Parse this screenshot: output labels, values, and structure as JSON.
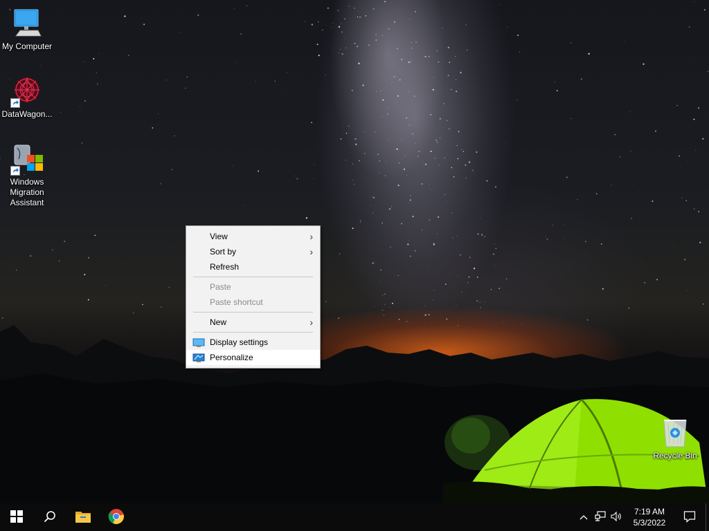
{
  "desktop": {
    "icons": [
      {
        "label": "My Computer",
        "icon": "monitor-icon"
      },
      {
        "label": "DataWagon...",
        "icon": "datawagon-icon"
      },
      {
        "label": "Windows Migration Assistant",
        "icon": "migration-assistant-icon"
      },
      {
        "label": "Recycle Bin",
        "icon": "recycle-bin-icon"
      }
    ]
  },
  "context_menu": {
    "items": [
      {
        "label": "View",
        "submenu": true,
        "enabled": true
      },
      {
        "label": "Sort by",
        "submenu": true,
        "enabled": true
      },
      {
        "label": "Refresh",
        "submenu": false,
        "enabled": true
      },
      {
        "label": "Paste",
        "submenu": false,
        "enabled": false
      },
      {
        "label": "Paste shortcut",
        "submenu": false,
        "enabled": false
      },
      {
        "label": "New",
        "submenu": true,
        "enabled": true
      },
      {
        "label": "Display settings",
        "submenu": false,
        "enabled": true,
        "icon": "display-settings-icon"
      },
      {
        "label": "Personalize",
        "submenu": false,
        "enabled": true,
        "icon": "personalize-icon",
        "highlighted": true
      }
    ],
    "submenu_glyph": "›"
  },
  "taskbar": {
    "apps": [
      {
        "name": "start",
        "icon": "windows-logo-icon"
      },
      {
        "name": "search",
        "icon": "search-icon"
      },
      {
        "name": "file-explorer",
        "icon": "folder-icon"
      },
      {
        "name": "chrome",
        "icon": "chrome-icon"
      }
    ],
    "tray": {
      "icons": [
        "chevron-up-icon",
        "network-icon",
        "volume-icon"
      ],
      "time": "7:19 AM",
      "date": "5/3/2022"
    }
  },
  "colors": {
    "menu_bg": "#f2f2f2",
    "menu_disabled": "#8a8a8a",
    "taskbar_bg": "#0b0b0b",
    "tent_green": "#8fe000",
    "sunset_orange": "#ff6a14"
  }
}
